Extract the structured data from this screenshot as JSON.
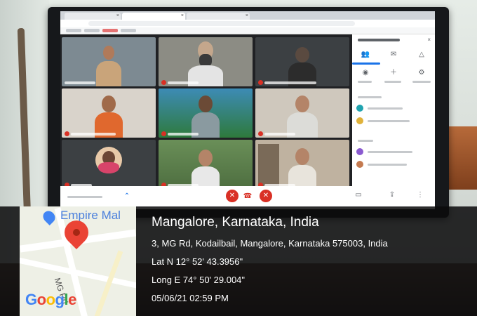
{
  "map": {
    "place_name": "Empire Mal",
    "road_label": "MG Rd",
    "logo": [
      "G",
      "o",
      "o",
      "g",
      "l",
      "e"
    ]
  },
  "location": {
    "city": "Mangalore, Karnataka, India",
    "address": "3, MG Rd, Kodailbail, Mangalore, Karnataka 575003, India",
    "latitude": "Lat N 12° 52' 43.3956\"",
    "longitude": "Long E 74° 50' 29.004\"",
    "datetime": "05/06/21 02:59 PM"
  },
  "colors": {
    "map_pin": "#ea4335",
    "meet_end_call": "#d93025",
    "overlay_bg": "#0a0a0c"
  }
}
